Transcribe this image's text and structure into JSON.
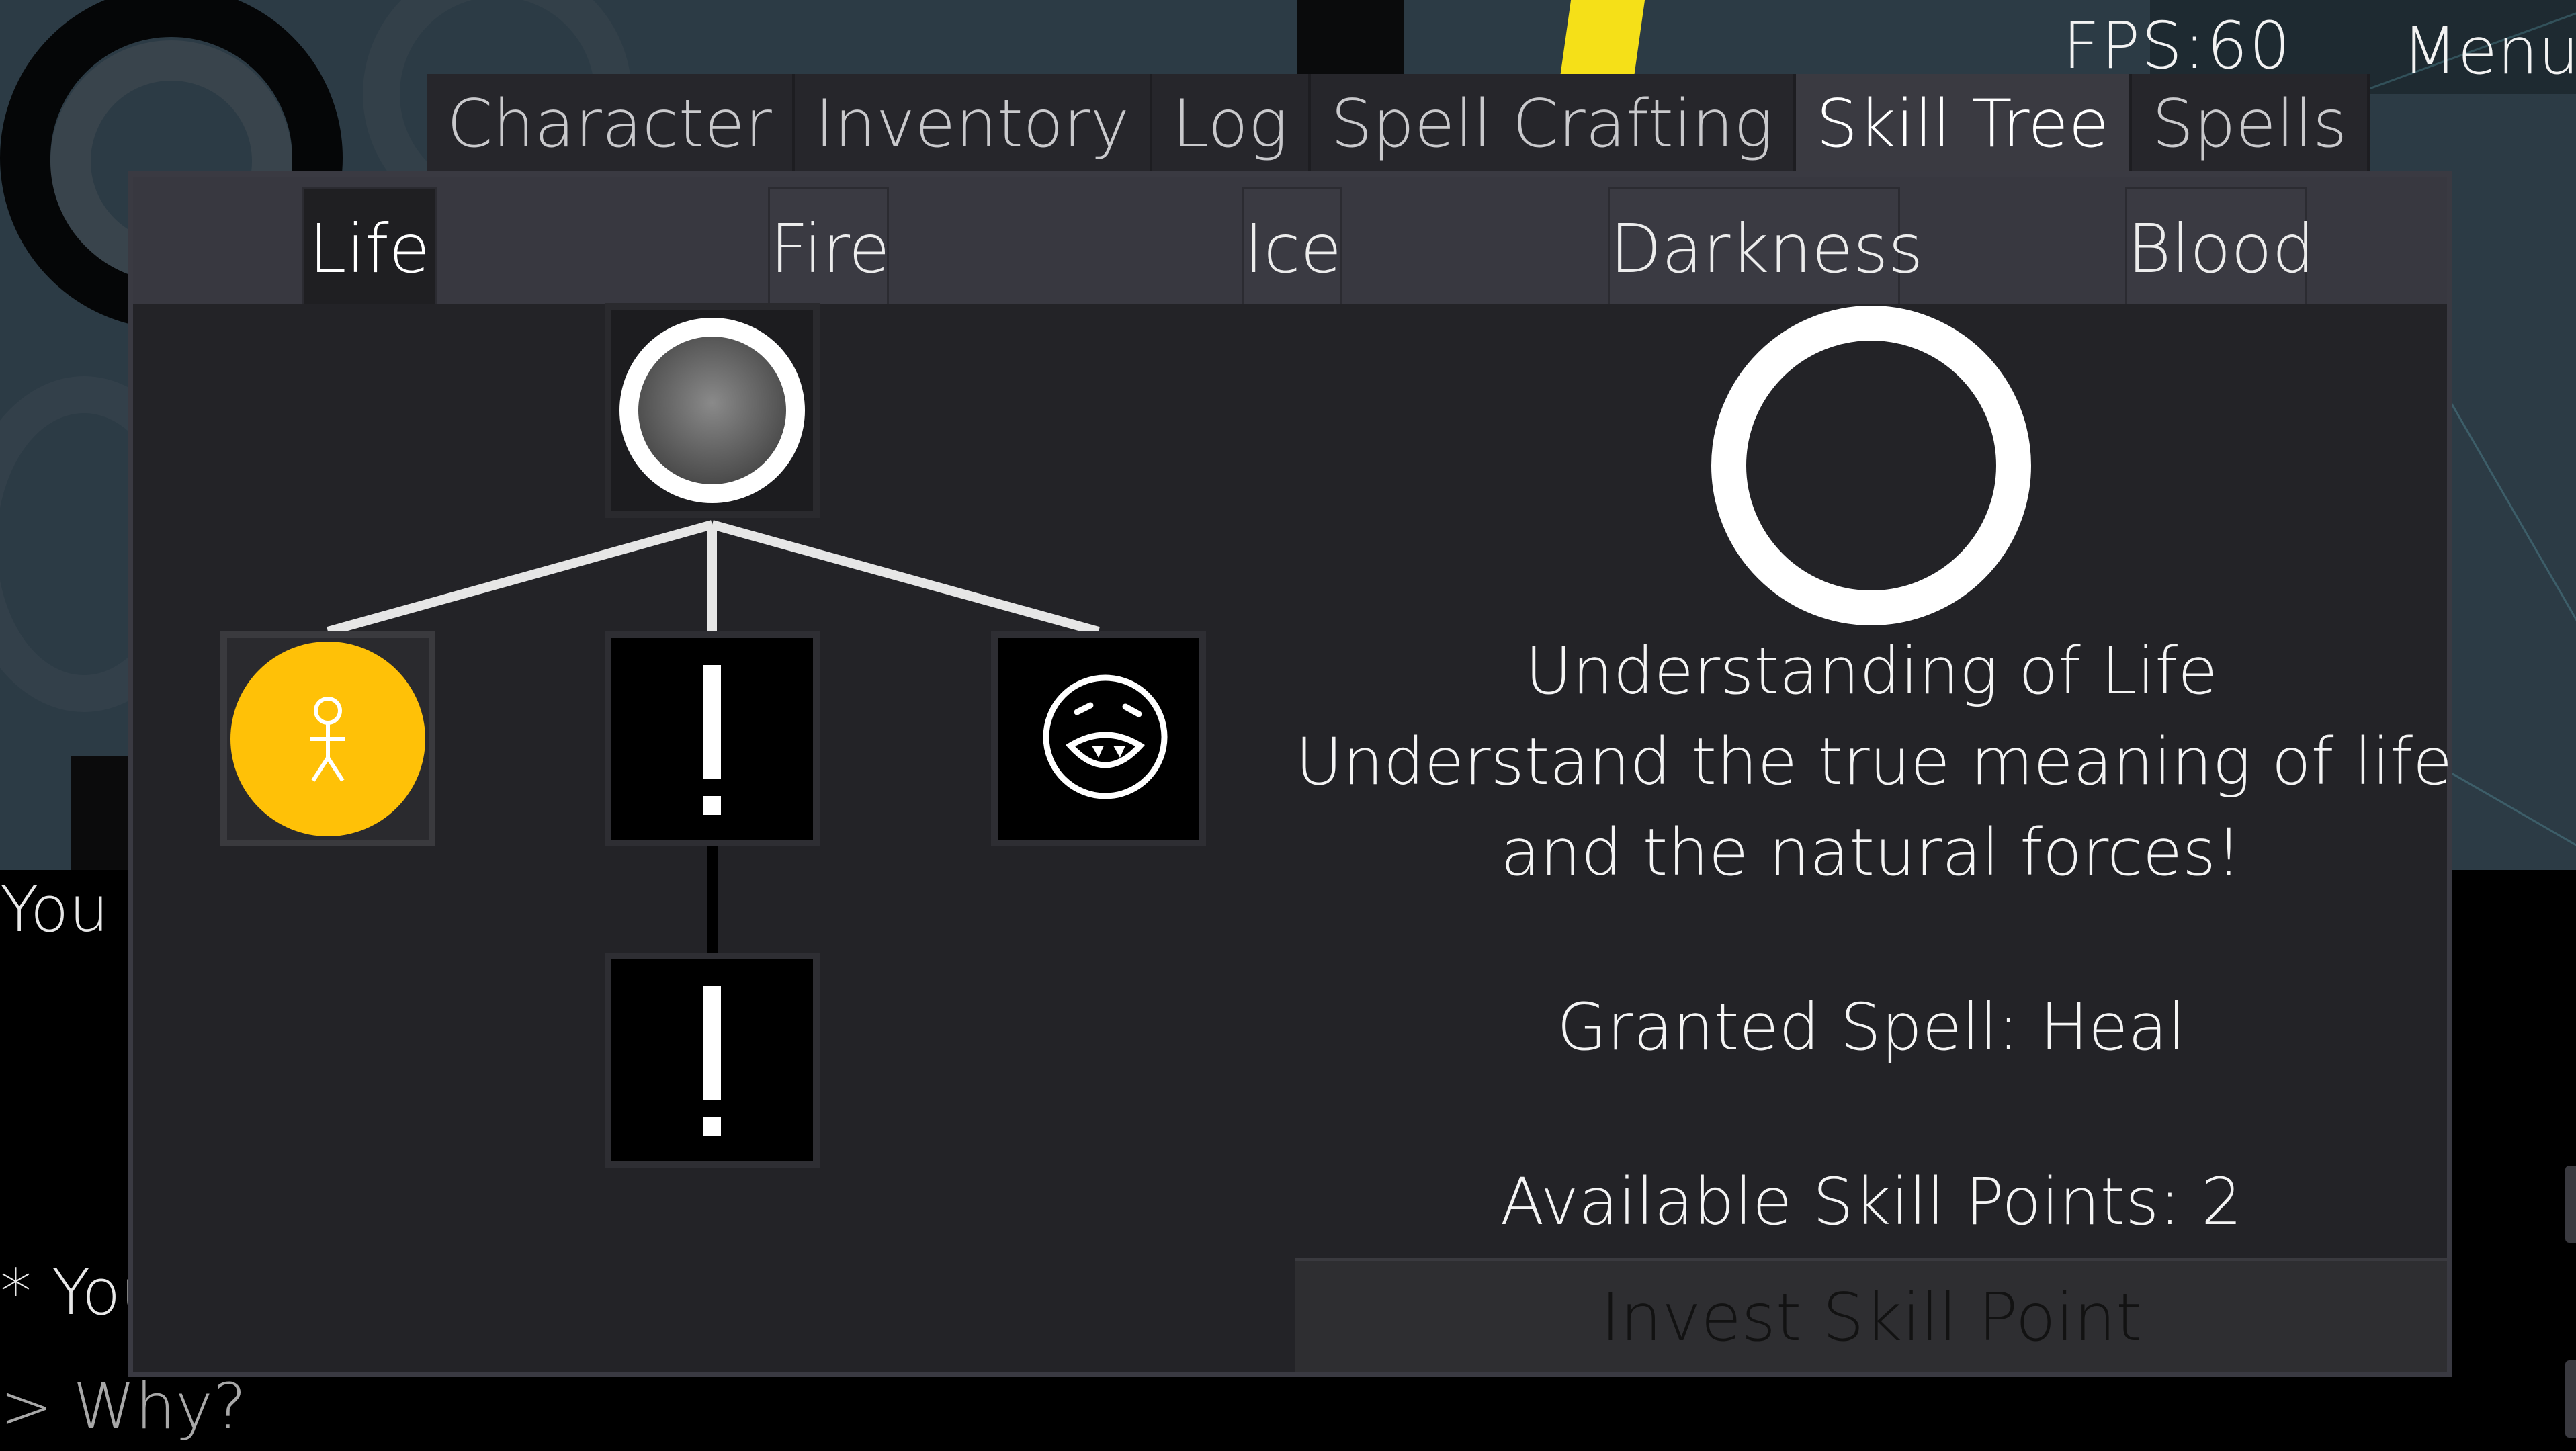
{
  "hud": {
    "fps": "FPS:60",
    "menu_label": "Menu"
  },
  "main_tabs": [
    {
      "label": "Character"
    },
    {
      "label": "Inventory"
    },
    {
      "label": "Log"
    },
    {
      "label": "Spell Crafting"
    },
    {
      "label": "Skill Tree",
      "active": true
    },
    {
      "label": "Spells"
    }
  ],
  "sub_tabs": [
    {
      "label": "Life",
      "active": true
    },
    {
      "label": "Fire"
    },
    {
      "label": "Ice"
    },
    {
      "label": "Darkness"
    },
    {
      "label": "Blood"
    }
  ],
  "skill_tree": {
    "nodes": [
      {
        "id": "root",
        "icon": "circle-icon",
        "state": "selected"
      },
      {
        "id": "child-left",
        "icon": "stick-figure-icon",
        "state": "unlocked",
        "color": "#ffc107"
      },
      {
        "id": "child-middle",
        "icon": "exclamation-icon",
        "state": "locked"
      },
      {
        "id": "child-right",
        "icon": "face-icon",
        "state": "available"
      },
      {
        "id": "grandchild",
        "icon": "exclamation-icon",
        "state": "locked"
      }
    ]
  },
  "detail": {
    "icon": "ring-icon",
    "skill_name": "Understanding of Life",
    "description_line1": "Understand the true meaning of life",
    "description_line2": "and the natural forces!",
    "granted_spell": "Granted Spell: Heal",
    "skill_points": "Available Skill Points: 2",
    "invest_label": "Invest Skill Point"
  },
  "chat": {
    "line1": "You",
    "line2": "* You",
    "input": "> Why?"
  },
  "colors": {
    "accent_yellow": "#ffc107",
    "panel_bg": "#232327",
    "tab_bar": "#383840",
    "connector": "#e0e0e0"
  }
}
